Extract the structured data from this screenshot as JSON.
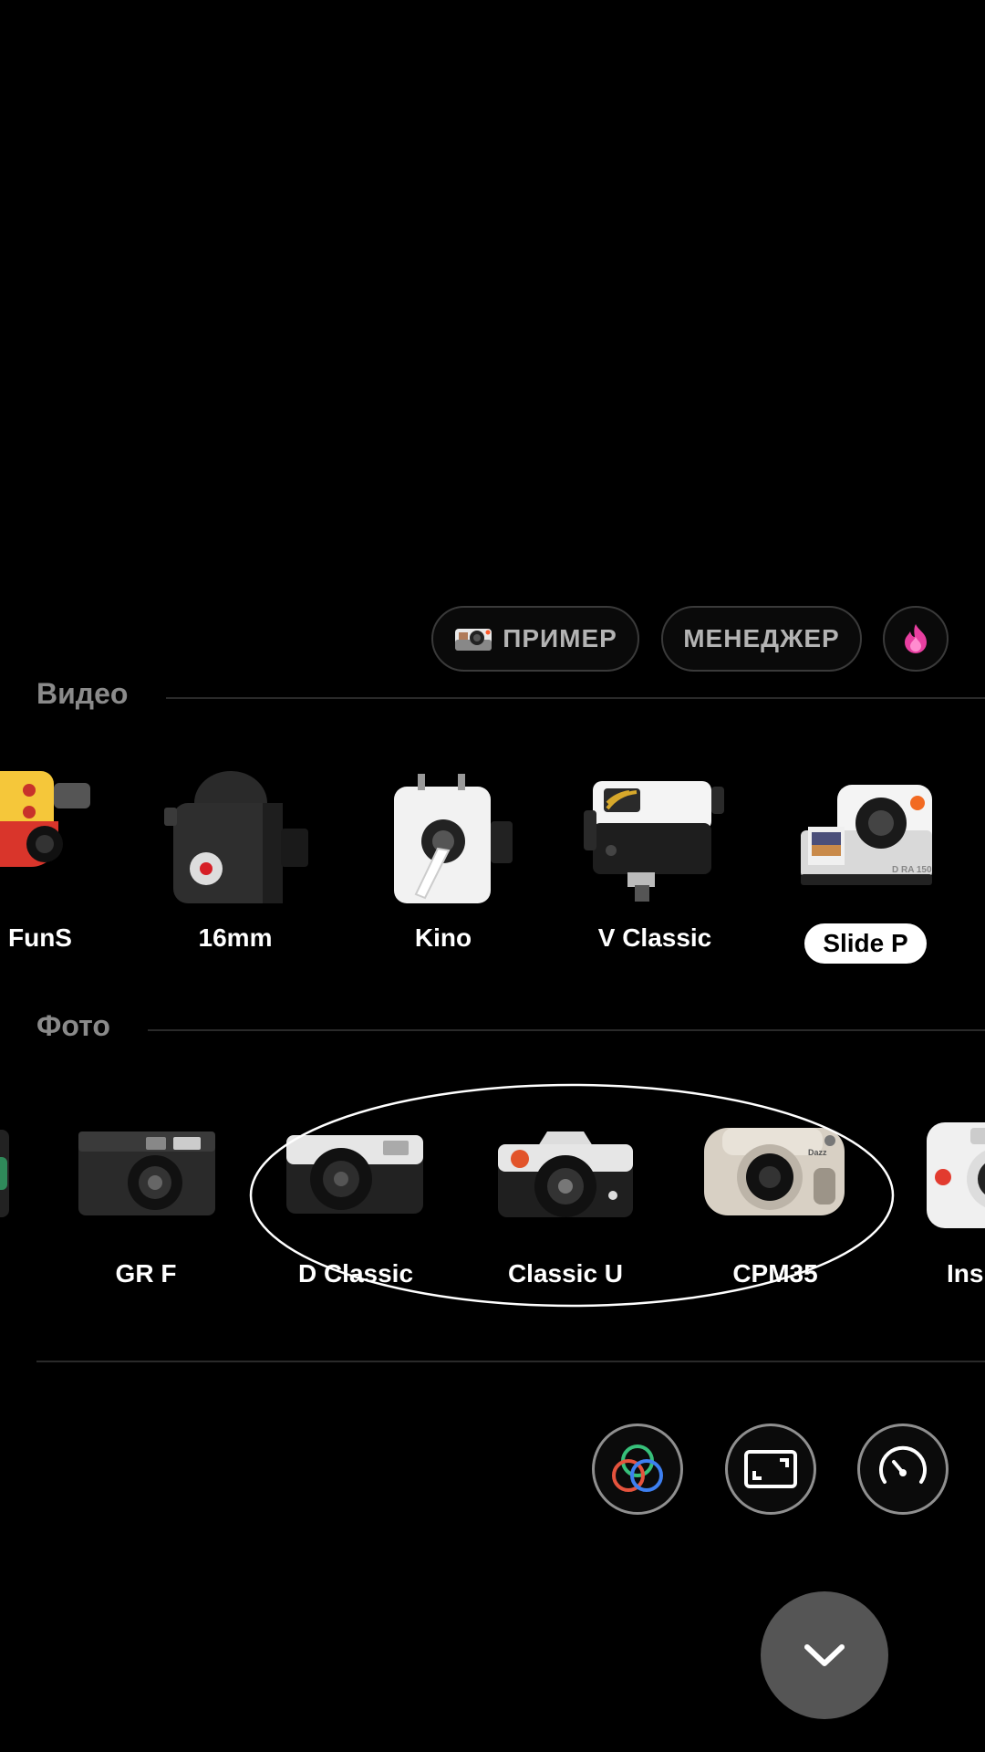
{
  "toolbar": {
    "example_label": "ПРИМЕР",
    "manager_label": "МЕНЕДЖЕР",
    "flame_icon": "flame-icon"
  },
  "video_section": {
    "title": "Видео",
    "cameras": [
      {
        "label": "FunS",
        "icon": "funs-camera-icon"
      },
      {
        "label": "16mm",
        "icon": "16mm-camera-icon"
      },
      {
        "label": "Kino",
        "icon": "kino-camera-icon"
      },
      {
        "label": "V Classic",
        "icon": "vclassic-camera-icon"
      },
      {
        "label": "Slide P",
        "icon": "slide-projector-icon",
        "selected": true
      }
    ]
  },
  "photo_section": {
    "title": "Фото",
    "cameras": [
      {
        "label": "GR F",
        "icon": "grf-camera-icon"
      },
      {
        "label": "D Classic",
        "icon": "dclassic-camera-icon"
      },
      {
        "label": "Classic U",
        "icon": "classicu-camera-icon"
      },
      {
        "label": "CPM35",
        "icon": "cpm35-camera-icon"
      },
      {
        "label": "Ins",
        "icon": "instant-camera-icon"
      }
    ]
  },
  "bottom_controls": {
    "filter_icon": "color-filter-icon",
    "aspect_icon": "aspect-ratio-icon",
    "speed_icon": "speedometer-icon",
    "collapse_icon": "chevron-down-icon"
  },
  "colors": {
    "background": "#000000",
    "accent_pink": "#e83fa0",
    "text_secondary": "#8a8a8a"
  }
}
